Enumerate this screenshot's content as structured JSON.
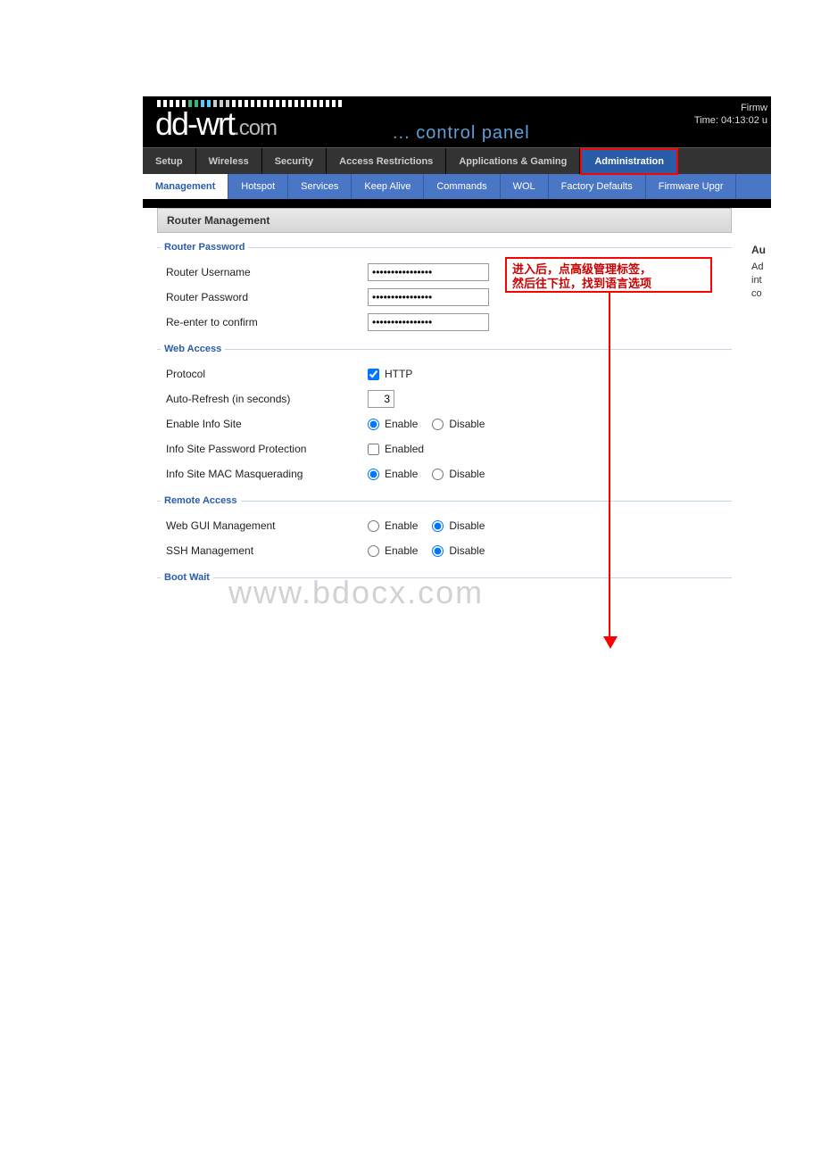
{
  "header": {
    "logo_main": "dd-wrt",
    "logo_sub": ".com",
    "control_panel": "... control panel",
    "firmware": "Firmw",
    "time": "Time: 04:13:02 u"
  },
  "tabs": [
    "Setup",
    "Wireless",
    "Security",
    "Access Restrictions",
    "Applications & Gaming",
    "Administration"
  ],
  "subtabs": [
    "Management",
    "Hotspot",
    "Services",
    "Keep Alive",
    "Commands",
    "WOL",
    "Factory Defaults",
    "Firmware Upgr"
  ],
  "page": {
    "title": "Router Management"
  },
  "router_password": {
    "legend": "Router Password",
    "username_label": "Router Username",
    "username_value": "••••••••••••••••",
    "password_label": "Router Password",
    "password_value": "••••••••••••••••",
    "confirm_label": "Re-enter to confirm",
    "confirm_value": "••••••••••••••••"
  },
  "web_access": {
    "legend": "Web Access",
    "protocol_label": "Protocol",
    "http_label": "HTTP",
    "refresh_label": "Auto-Refresh (in seconds)",
    "refresh_value": "3",
    "info_label": "Enable Info Site",
    "infopw_label": "Info Site Password Protection",
    "infopw_enabled": "Enabled",
    "macmasq_label": "Info Site MAC Masquerading",
    "enable": "Enable",
    "disable": "Disable"
  },
  "remote_access": {
    "legend": "Remote Access",
    "webgui_label": "Web GUI Management",
    "ssh_label": "SSH Management",
    "enable": "Enable",
    "disable": "Disable"
  },
  "boot_wait": {
    "legend": "Boot Wait"
  },
  "help": {
    "title": "Au",
    "line1": "Ad",
    "line2": "int",
    "line3": "co"
  },
  "callout": {
    "line1": "进入后，点高级管理标签，",
    "line2": "然后往下拉，找到语言选项"
  },
  "watermark": "www.bdocx.com"
}
